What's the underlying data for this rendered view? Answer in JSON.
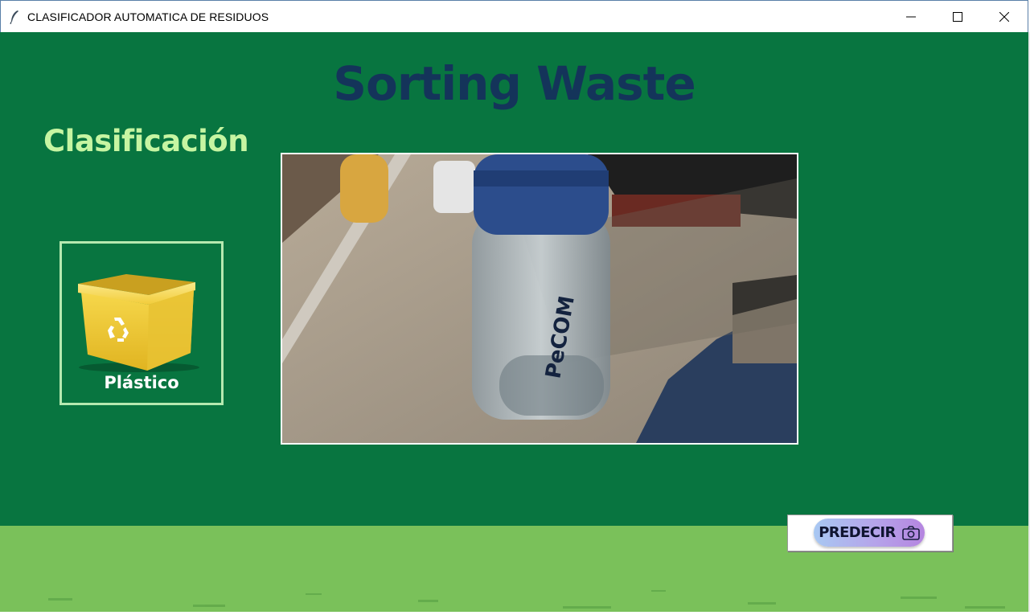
{
  "window": {
    "title": "CLASIFICADOR AUTOMATICA DE RESIDUOS",
    "icon": "feather-icon",
    "controls": [
      "minimize-icon",
      "maximize-icon",
      "close-icon"
    ]
  },
  "header": {
    "title": "Sorting Waste",
    "subtitle": "Clasificación"
  },
  "result": {
    "label": "Plástico",
    "icon": "yellow-recycling-bin-icon"
  },
  "camera": {
    "description_icon": "camera-feed-image"
  },
  "actions": {
    "predict_label": "PREDECIR",
    "predict_icon": "camera-icon"
  },
  "colors": {
    "background": "#087540",
    "heading": "#14345a",
    "subheading": "#c6f5a2",
    "grass": "#7ac15a",
    "bin": "#f5d448"
  }
}
